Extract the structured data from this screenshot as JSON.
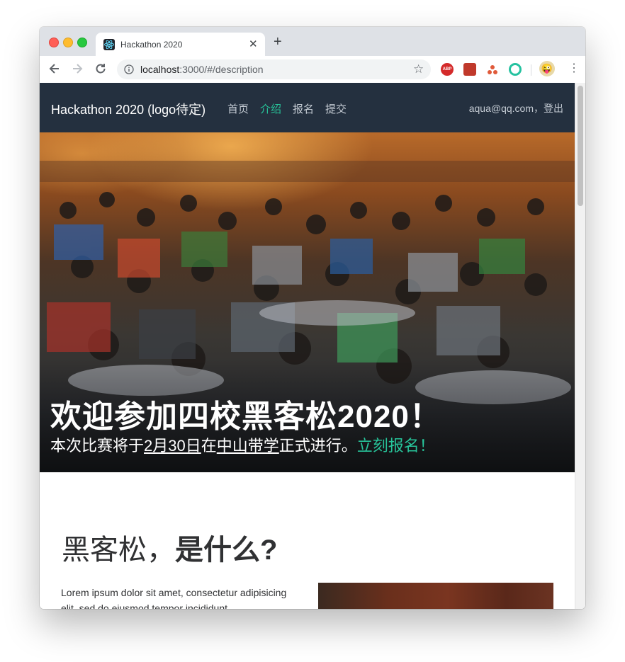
{
  "browser": {
    "tab_title": "Hackathon 2020",
    "url_host": "localhost",
    "url_rest": ":3000/#/description",
    "ext_abp": "ABP",
    "avatar": "😜"
  },
  "nav": {
    "brand": "Hackathon 2020 (logo待定)",
    "links": [
      "首页",
      "介绍",
      "报名",
      "提交"
    ],
    "active_index": 1,
    "user_email": "aqua@qq.com",
    "sep": "，",
    "logout": "登出"
  },
  "hero": {
    "heading": "欢迎参加四校黑客松2020！",
    "sub_prefix": "本次比赛将于",
    "date": "2月30日",
    "sub_mid": "在",
    "location": "中山带学",
    "sub_suffix": "正式进行。",
    "cta": "立刻报名！"
  },
  "section": {
    "title_light": "黑客松，",
    "title_bold": "是什么?",
    "paragraph": "Lorem ipsum dolor sit amet, consectetur adipisicing elit, sed do eiusmod tempor incididunt"
  },
  "colors": {
    "accent": "#27c49a",
    "navbar_bg": "#24303f"
  }
}
